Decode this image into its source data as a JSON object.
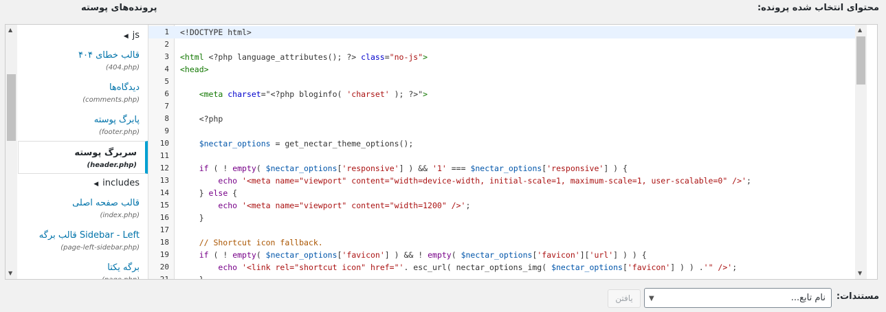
{
  "header": {
    "content_title": "محتوای انتخاب شده پرونده:",
    "files_title": "پرونده‌های پوسته"
  },
  "file_list": {
    "folders": [
      {
        "name": "js",
        "expand_icon": "triangle-left-icon"
      },
      {
        "name": "includes",
        "expand_icon": "triangle-left-icon"
      }
    ],
    "files_group1": [
      {
        "label": "قالب خطای ۴۰۴",
        "file": "(404.php)",
        "selected": false
      },
      {
        "label": "دیدگاه‌ها",
        "file": "(comments.php)",
        "selected": false
      },
      {
        "label": "پابرگ پوسته",
        "file": "(footer.php)",
        "selected": false
      },
      {
        "label": "سربرگ پوسته",
        "file": "(header.php)",
        "selected": true
      }
    ],
    "files_group2": [
      {
        "label": "قالب صفحه اصلی",
        "file": "(index.php)",
        "selected": false
      },
      {
        "label": "Sidebar - Left قالب برگه",
        "file": "(page-left-sidebar.php)",
        "selected": false
      },
      {
        "label": "برگه یکتا",
        "file": "(page.php)",
        "selected": false
      }
    ]
  },
  "editor": {
    "accent_color": "#00a0d2",
    "line_numbers": [
      "1",
      "2",
      "3",
      "4",
      "5",
      "6",
      "7",
      "8",
      "9",
      "10",
      "11",
      "12",
      "13",
      "14",
      "15",
      "16",
      "17",
      "18",
      "19",
      "20",
      "21"
    ],
    "lines": [
      [
        {
          "t": "<!DOCTYPE html>",
          "c": "def"
        }
      ],
      [],
      [
        {
          "t": "<html ",
          "c": "tag"
        },
        {
          "t": "<?php language_attributes(); ?>",
          "c": "def"
        },
        {
          "t": " class",
          "c": "attr"
        },
        {
          "t": "=",
          "c": "def"
        },
        {
          "t": "\"no-js\"",
          "c": "str"
        },
        {
          "t": ">",
          "c": "tag"
        }
      ],
      [
        {
          "t": "<head>",
          "c": "tag"
        }
      ],
      [],
      [
        {
          "t": "    <meta ",
          "c": "tag"
        },
        {
          "t": "charset",
          "c": "attr"
        },
        {
          "t": "=",
          "c": "def"
        },
        {
          "t": "\"<?php bloginfo( ",
          "c": "def"
        },
        {
          "t": "'charset'",
          "c": "str"
        },
        {
          "t": " ); ?>\"",
          "c": "def"
        },
        {
          "t": ">",
          "c": "tag"
        }
      ],
      [],
      [
        {
          "t": "    <?php",
          "c": "def"
        }
      ],
      [],
      [
        {
          "t": "    ",
          "c": "def"
        },
        {
          "t": "$nectar_options",
          "c": "var"
        },
        {
          "t": " = get_nectar_theme_options();",
          "c": "def"
        }
      ],
      [],
      [
        {
          "t": "    ",
          "c": "def"
        },
        {
          "t": "if",
          "c": "kw"
        },
        {
          "t": " ( ! ",
          "c": "def"
        },
        {
          "t": "empty",
          "c": "kw"
        },
        {
          "t": "( ",
          "c": "def"
        },
        {
          "t": "$nectar_options",
          "c": "var"
        },
        {
          "t": "[",
          "c": "def"
        },
        {
          "t": "'responsive'",
          "c": "str"
        },
        {
          "t": "] ) && ",
          "c": "def"
        },
        {
          "t": "'1'",
          "c": "str"
        },
        {
          "t": " === ",
          "c": "def"
        },
        {
          "t": "$nectar_options",
          "c": "var"
        },
        {
          "t": "[",
          "c": "def"
        },
        {
          "t": "'responsive'",
          "c": "str"
        },
        {
          "t": "] ) {",
          "c": "def"
        }
      ],
      [
        {
          "t": "        ",
          "c": "def"
        },
        {
          "t": "echo",
          "c": "kw"
        },
        {
          "t": " ",
          "c": "def"
        },
        {
          "t": "'<meta name=\"viewport\" content=\"width=device-width, initial-scale=1, maximum-scale=1, user-scalable=0\" />'",
          "c": "str"
        },
        {
          "t": ";",
          "c": "def"
        }
      ],
      [
        {
          "t": "    } ",
          "c": "def"
        },
        {
          "t": "else",
          "c": "kw"
        },
        {
          "t": " {",
          "c": "def"
        }
      ],
      [
        {
          "t": "        ",
          "c": "def"
        },
        {
          "t": "echo",
          "c": "kw"
        },
        {
          "t": " ",
          "c": "def"
        },
        {
          "t": "'<meta name=\"viewport\" content=\"width=1200\" />'",
          "c": "str"
        },
        {
          "t": ";",
          "c": "def"
        }
      ],
      [
        {
          "t": "    }",
          "c": "def"
        }
      ],
      [],
      [
        {
          "t": "    // Shortcut icon fallback.",
          "c": "cm"
        }
      ],
      [
        {
          "t": "    ",
          "c": "def"
        },
        {
          "t": "if",
          "c": "kw"
        },
        {
          "t": " ( ! ",
          "c": "def"
        },
        {
          "t": "empty",
          "c": "kw"
        },
        {
          "t": "( ",
          "c": "def"
        },
        {
          "t": "$nectar_options",
          "c": "var"
        },
        {
          "t": "[",
          "c": "def"
        },
        {
          "t": "'favicon'",
          "c": "str"
        },
        {
          "t": "] ) && ! ",
          "c": "def"
        },
        {
          "t": "empty",
          "c": "kw"
        },
        {
          "t": "( ",
          "c": "def"
        },
        {
          "t": "$nectar_options",
          "c": "var"
        },
        {
          "t": "[",
          "c": "def"
        },
        {
          "t": "'favicon'",
          "c": "str"
        },
        {
          "t": "][",
          "c": "def"
        },
        {
          "t": "'url'",
          "c": "str"
        },
        {
          "t": "] ) ) {",
          "c": "def"
        }
      ],
      [
        {
          "t": "        ",
          "c": "def"
        },
        {
          "t": "echo",
          "c": "kw"
        },
        {
          "t": " ",
          "c": "def"
        },
        {
          "t": "'<link rel=\"shortcut icon\" href=\"'",
          "c": "str"
        },
        {
          "t": ". esc_url( nectar_options_img( ",
          "c": "def"
        },
        {
          "t": "$nectar_options",
          "c": "var"
        },
        {
          "t": "[",
          "c": "def"
        },
        {
          "t": "'favicon'",
          "c": "str"
        },
        {
          "t": "] ) ) .",
          "c": "def"
        },
        {
          "t": "'\" />'",
          "c": "str"
        },
        {
          "t": ";",
          "c": "def"
        }
      ],
      [
        {
          "t": "    }",
          "c": "def"
        }
      ]
    ]
  },
  "bottom": {
    "doc_label": "مستندات:",
    "select_placeholder": "نام تابع...",
    "find_button": "یافتن"
  }
}
